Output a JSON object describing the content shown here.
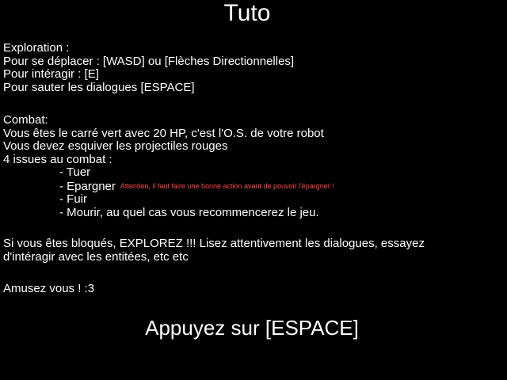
{
  "title": "Tuto",
  "exploration": {
    "heading": "Exploration :",
    "lines": [
      "Pour se déplacer : [WASD] ou [Flèches Directionnelles]",
      "Pour intéragir : [E]",
      "Pour sauter les dialogues [ESPACE]"
    ]
  },
  "combat": {
    "heading": "Combat:",
    "lines": [
      "Vous êtes le carré vert avec 20 HP, c'est l'O.S. de votre robot",
      "Vous devez esquiver les projectiles rouges",
      "4 issues au combat :"
    ],
    "outcomes": [
      "- Tuer",
      "- Epargner",
      "- Fuir",
      "- Mourir, au quel cas vous recommencerez le jeu."
    ],
    "spare_warning": "Attention, il faut faire une bonne action avant de pouvoir l'épargner !"
  },
  "help": {
    "lines": [
      "Si vous êtes bloqués, EXPLOREZ !!! Lisez attentivement les dialogues, essayez",
      "d'intéragir avec les entitées, etc etc"
    ]
  },
  "fun": "Amusez vous ! :3",
  "prompt": "Appuyez sur [ESPACE]",
  "colors": {
    "background": "#000000",
    "text": "#ffffff",
    "warning": "#ff4444"
  }
}
